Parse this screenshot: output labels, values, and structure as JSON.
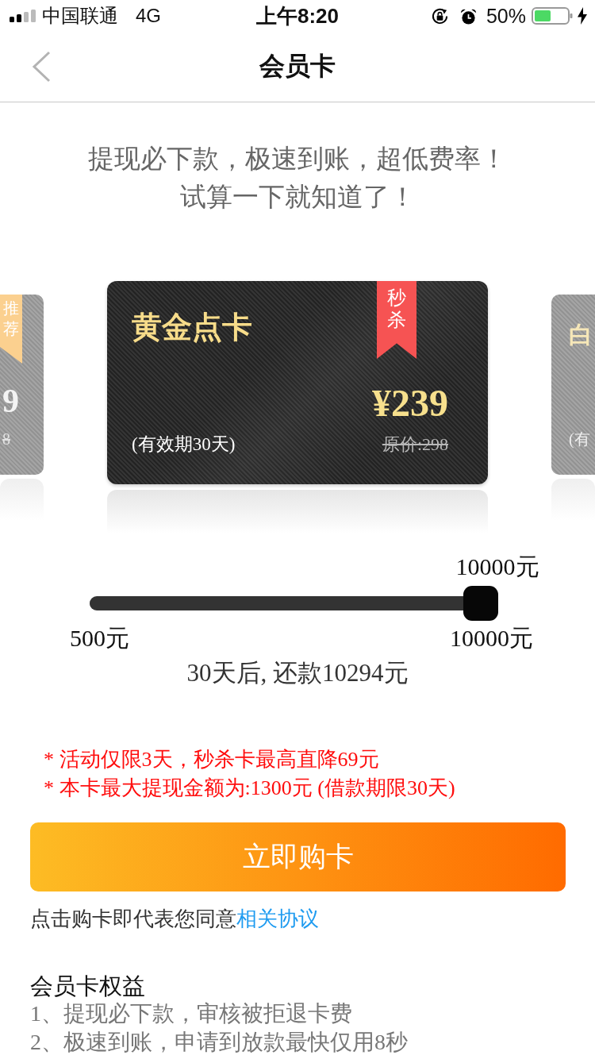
{
  "status_bar": {
    "carrier": "中国联通",
    "network": "4G",
    "time": "上午8:20",
    "battery": "50%"
  },
  "nav_bar": {
    "title": "会员卡"
  },
  "headline": [
    "提现必下款，极速到账，超低费率！",
    "试算一下就知道了！"
  ],
  "cards": [
    {
      "selected": false,
      "ribbon": {
        "text": "推荐",
        "color": "#fbd08f"
      },
      "price": "9",
      "original_price": "8"
    },
    {
      "selected": true,
      "title": "黄金点卡",
      "ribbon": {
        "text": "秒杀",
        "color": "#f65353"
      },
      "price": "¥239",
      "original_price": "原价:298",
      "validity": "(有效期30天)"
    },
    {
      "selected": false,
      "title": "白",
      "validity": "(有"
    }
  ],
  "slider": {
    "value": "10000元",
    "min_label": "500元",
    "max_label": "10000元",
    "level": 1
  },
  "result": "30天后, 还款10294元",
  "notes": [
    "* 活动仅限3天，秒杀卡最高直降69元",
    "* 本卡最大提现金额为:1300元 (借款期限30天)"
  ],
  "buy_button": "立即购卡",
  "agreement": {
    "text": "点击购卡即代表您同意",
    "link": "相关协议"
  },
  "benefits": {
    "title": "会员卡权益",
    "items": [
      "1、提现必下款，审核被拒退卡费",
      "2、极速到账，申请到放款最快仅用8秒"
    ]
  }
}
